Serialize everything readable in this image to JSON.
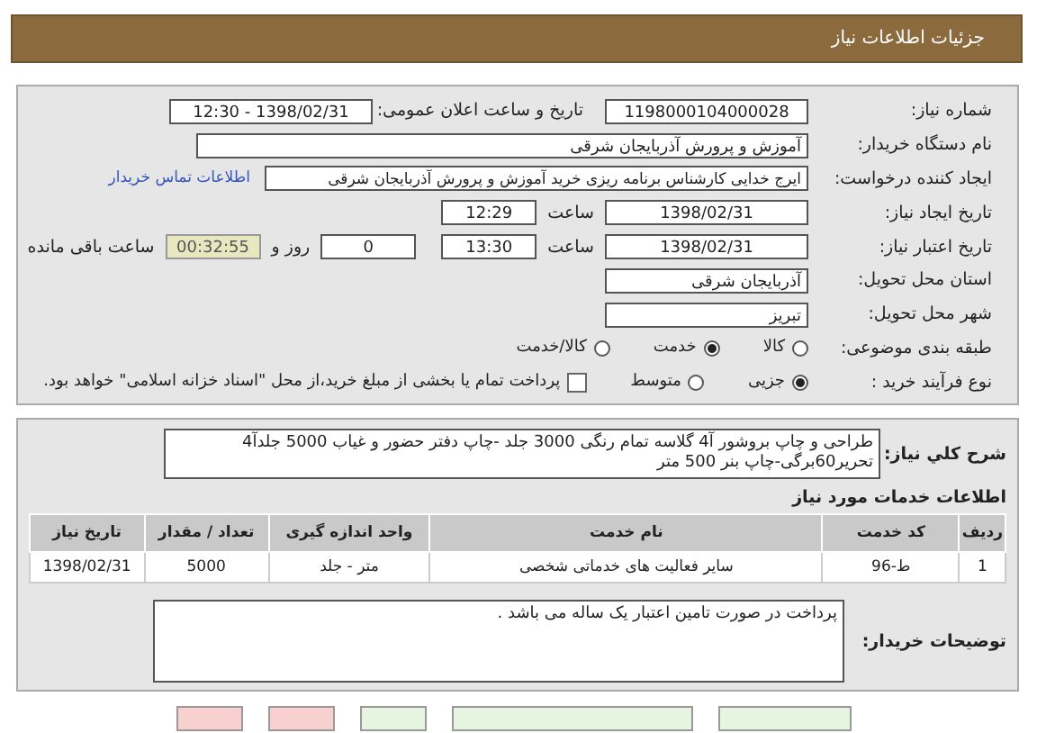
{
  "header": {
    "title": "جزئیات اطلاعات نیاز"
  },
  "need_number": {
    "label": "شماره نیاز:",
    "value": "1198000104000028"
  },
  "announce": {
    "label": "تاریخ و ساعت اعلان عمومی:",
    "value": "1398/02/31 - 12:30"
  },
  "buyer": {
    "label": "نام دستگاه خریدار:",
    "value": "آموزش و پرورش آذربایجان شرقی"
  },
  "creator": {
    "label": "ایجاد کننده درخواست:",
    "value": "ایرج خدایی کارشناس برنامه ریزی خرید آموزش و پرورش آذربایجان شرقی",
    "link": "اطلاعات تماس خریدار"
  },
  "created": {
    "label": "تاریخ ایجاد نیاز:",
    "date": "1398/02/31",
    "time_label": "ساعت",
    "time": "12:29"
  },
  "validity": {
    "label": "تاریخ اعتبار نیاز:",
    "date": "1398/02/31",
    "time_label": "ساعت",
    "time": "13:30",
    "days": "0",
    "days_label": "روز و",
    "remaining": "00:32:55",
    "remaining_label": "ساعت باقی مانده"
  },
  "province": {
    "label": "استان محل تحویل:",
    "value": "آذربایجان شرقی"
  },
  "city": {
    "label": "شهر محل تحویل:",
    "value": "تبریز"
  },
  "category": {
    "label": "طبقه بندی موضوعی:",
    "options": [
      {
        "label": "کالا",
        "selected": false
      },
      {
        "label": "خدمت",
        "selected": true
      },
      {
        "label": "کالا/خدمت",
        "selected": false
      }
    ]
  },
  "process": {
    "label": "نوع فرآیند خرید :",
    "options": [
      {
        "label": "جزیی",
        "selected": true
      },
      {
        "label": "متوسط",
        "selected": false
      }
    ],
    "treasury": {
      "checked": false,
      "label": "پرداخت تمام یا بخشی از مبلغ خرید،از محل \"اسناد خزانه اسلامی\" خواهد بود."
    }
  },
  "description": {
    "label": "شرح کلي نياز:",
    "value": "طراحی و چاپ بروشور آ4 گلاسه تمام رنگی 3000 جلد -چاپ دفتر حضور و غیاب 5000 جلدآ4 تحریر60برگی-چاپ بنر 500 متر"
  },
  "services": {
    "title": "اطلاعات خدمات مورد نیاز",
    "columns": [
      "ردیف",
      "کد خدمت",
      "نام خدمت",
      "واحد اندازه گیری",
      "تعداد / مقدار",
      "تاریخ نیاز"
    ],
    "rows": [
      [
        "1",
        "ط-96",
        "سایر فعالیت های خدماتی شخصی",
        "متر - جلد",
        "5000",
        "1398/02/31"
      ]
    ]
  },
  "notes": {
    "label": "توضیحات خریدار:",
    "value": "پرداخت در صورت تامین اعتبار یک ساله می باشد ."
  },
  "buttons": [
    {
      "color": "#e6f5e0"
    },
    {
      "color": "#e6f5e0"
    },
    {
      "color": "#e6f5e0"
    },
    {
      "color": "#f8d0d0"
    },
    {
      "color": "#f8d0d0"
    }
  ]
}
